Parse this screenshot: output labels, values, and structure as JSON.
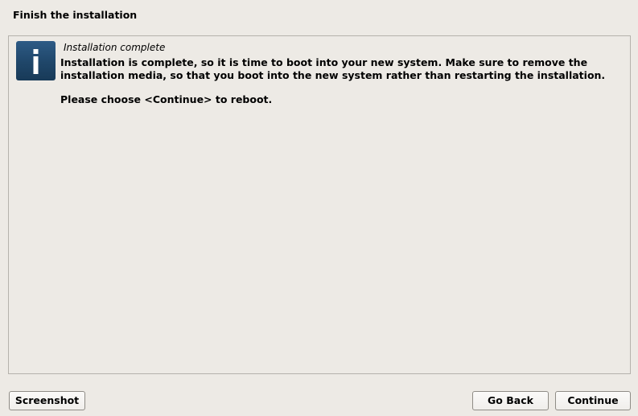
{
  "header": {
    "title": "Finish the installation"
  },
  "message": {
    "icon": "info-icon",
    "icon_color": "#1f4669",
    "title": "Installation complete",
    "body": "Installation is complete, so it is time to boot into your new system. Make sure to remove the\ninstallation media, so that you boot into the new system rather than restarting the installation.",
    "prompt": "Please choose <Continue> to reboot."
  },
  "footer": {
    "screenshot_label": "Screenshot",
    "go_back_label": "Go Back",
    "continue_label": "Continue"
  }
}
